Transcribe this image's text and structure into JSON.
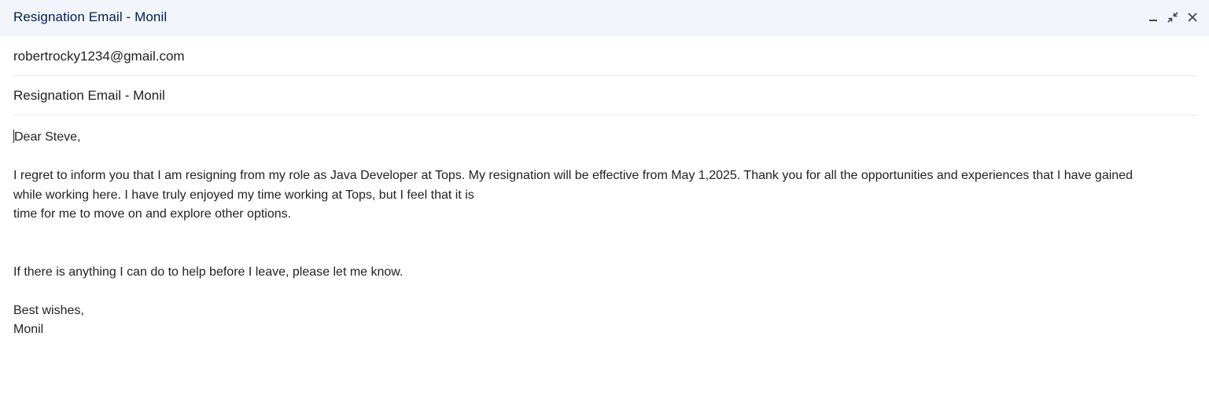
{
  "window": {
    "title": "Resignation Email - Monil",
    "controls": [
      {
        "name": "minimize-icon"
      },
      {
        "name": "exit-fullscreen-icon"
      },
      {
        "name": "close-icon"
      }
    ]
  },
  "recipient": {
    "value": "robertrocky1234@gmail.com"
  },
  "subject": {
    "value": "Resignation Email - Monil"
  },
  "body": {
    "greeting": "Dear Steve,",
    "paragraph1_line1": "I regret to inform you that I am resigning from my role as Java Developer at Tops. My resignation will be effective from May 1,2025. Thank you for all the opportunities and experiences that I have gained",
    "paragraph1_line2": "while working here. I have truly enjoyed my time working at Tops, but I feel that it is",
    "paragraph1_line3": "time for me to move on and explore other options.",
    "paragraph2": "If there is anything I can do to help before I leave, please let me know.",
    "closing": "Best wishes,",
    "signature": "Monil"
  },
  "colors": {
    "titlebar_bg": "#f2f6fc",
    "title_text": "#041e49",
    "body_text": "#222222",
    "divider": "#e6e8eb"
  }
}
